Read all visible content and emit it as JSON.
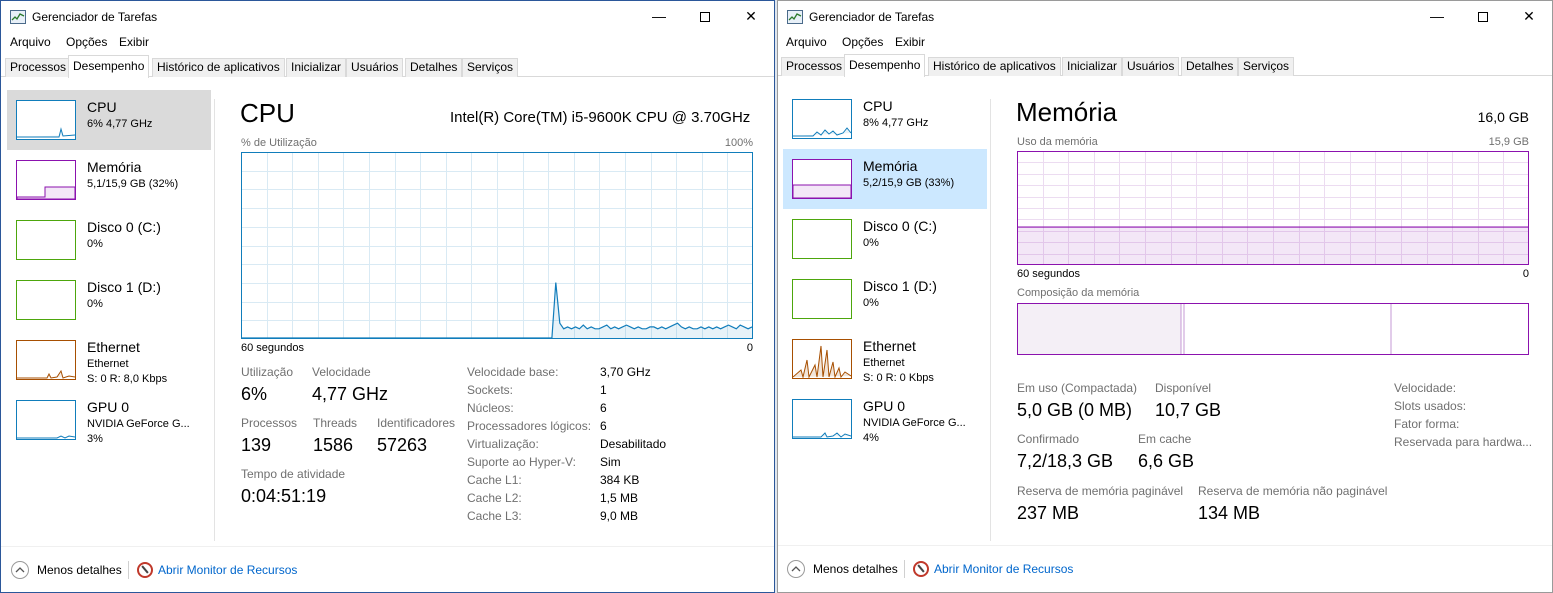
{
  "windowA": {
    "title": "Gerenciador de Tarefas",
    "window_buttons": {
      "minimize": "—",
      "close": "✕"
    },
    "menu": [
      "Arquivo",
      "Opções",
      "Exibir"
    ],
    "tabs": [
      "Processos",
      "Desempenho",
      "Histórico de aplicativos",
      "Inicializar",
      "Usuários",
      "Detalhes",
      "Serviços"
    ],
    "active_tab": "Desempenho",
    "sidebar": [
      {
        "title": "CPU",
        "sub": "6% 4,77 GHz",
        "sub2": ""
      },
      {
        "title": "Memória",
        "sub": "5,1/15,9 GB (32%)",
        "sub2": ""
      },
      {
        "title": "Disco 0 (C:)",
        "sub": "0%",
        "sub2": ""
      },
      {
        "title": "Disco 1 (D:)",
        "sub": "0%",
        "sub2": ""
      },
      {
        "title": "Ethernet",
        "sub": "Ethernet",
        "sub2": "S: 0 R: 8,0 Kbps"
      },
      {
        "title": "GPU 0",
        "sub": "NVIDIA GeForce G...",
        "sub2": "3%"
      }
    ],
    "panel": {
      "title": "CPU",
      "processor": "Intel(R) Core(TM) i5-9600K CPU @ 3.70GHz",
      "graph_label_left": "% de Utilização",
      "graph_label_right": "100%",
      "graph_bottom_left": "60 segundos",
      "graph_bottom_right": "0",
      "stats": {
        "utilizacao_label": "Utilização",
        "utilizacao": "6%",
        "velocidade_label": "Velocidade",
        "velocidade": "4,77 GHz",
        "processos_label": "Processos",
        "processos": "139",
        "threads_label": "Threads",
        "threads": "1586",
        "identificadores_label": "Identificadores",
        "identificadores": "57263",
        "tempo_label": "Tempo de atividade",
        "tempo": "0:04:51:19"
      },
      "details": [
        {
          "k": "Velocidade base:",
          "v": "3,70 GHz"
        },
        {
          "k": "Sockets:",
          "v": "1"
        },
        {
          "k": "Núcleos:",
          "v": "6"
        },
        {
          "k": "Processadores lógicos:",
          "v": "6"
        },
        {
          "k": "Virtualização:",
          "v": "Desabilitado"
        },
        {
          "k": "Suporte ao Hyper-V:",
          "v": "Sim"
        },
        {
          "k": "Cache L1:",
          "v": "384 KB"
        },
        {
          "k": "Cache L2:",
          "v": "1,5 MB"
        },
        {
          "k": "Cache L3:",
          "v": "9,0 MB"
        }
      ],
      "cpu_usage_series": [
        0,
        0,
        0,
        0,
        0,
        0,
        0,
        0,
        0,
        0,
        0,
        0,
        0,
        0,
        0,
        0,
        0,
        0,
        0,
        0,
        0,
        0,
        0,
        0,
        0,
        0,
        0,
        0,
        0,
        0,
        0,
        0,
        0,
        0,
        0,
        0,
        0,
        0,
        0,
        0,
        0,
        0,
        0,
        0,
        0,
        0,
        0,
        0,
        0,
        0,
        0,
        0,
        0,
        0,
        0,
        0,
        0,
        0,
        0,
        0,
        0,
        0,
        0,
        0,
        0,
        0,
        0,
        0,
        0,
        0,
        0,
        0,
        0,
        0,
        0,
        0,
        0,
        0,
        0,
        0,
        30,
        8,
        5,
        6,
        5,
        6,
        5,
        7,
        5,
        6,
        5,
        5,
        6,
        7,
        5,
        6,
        5,
        6,
        7,
        6,
        5,
        6,
        5,
        5,
        6,
        6,
        5,
        6,
        5,
        6,
        7,
        8,
        6,
        5,
        6,
        5,
        5,
        6,
        5,
        6,
        5,
        6,
        5,
        6,
        7,
        6,
        5,
        7,
        6,
        5,
        6
      ]
    },
    "footer": {
      "less": "Menos detalhes",
      "monitor": "Abrir Monitor de Recursos"
    }
  },
  "windowB": {
    "title": "Gerenciador de Tarefas",
    "window_buttons": {
      "minimize": "—",
      "close": "✕"
    },
    "menu": [
      "Arquivo",
      "Opções",
      "Exibir"
    ],
    "tabs": [
      "Processos",
      "Desempenho",
      "Histórico de aplicativos",
      "Inicializar",
      "Usuários",
      "Detalhes",
      "Serviços"
    ],
    "active_tab": "Desempenho",
    "sidebar": [
      {
        "title": "CPU",
        "sub": "8% 4,77 GHz",
        "sub2": ""
      },
      {
        "title": "Memória",
        "sub": "5,2/15,9 GB (33%)",
        "sub2": ""
      },
      {
        "title": "Disco 0 (C:)",
        "sub": "0%",
        "sub2": ""
      },
      {
        "title": "Disco 1 (D:)",
        "sub": "0%",
        "sub2": ""
      },
      {
        "title": "Ethernet",
        "sub": "Ethernet",
        "sub2": "S: 0 R: 0 Kbps"
      },
      {
        "title": "GPU 0",
        "sub": "NVIDIA GeForce G...",
        "sub2": "4%"
      }
    ],
    "panel": {
      "title": "Memória",
      "total": "16,0 GB",
      "graph_label_left": "Uso da memória",
      "graph_label_right": "15,9 GB",
      "graph_bottom_left": "60 segundos",
      "graph_bottom_right": "0",
      "composition_label": "Composição da memória",
      "memory_usage_fraction": 0.33,
      "stats": {
        "em_uso_label": "Em uso (Compactada)",
        "em_uso": "5,0 GB (0 MB)",
        "disponivel_label": "Disponível",
        "disponivel": "10,7 GB",
        "confirmado_label": "Confirmado",
        "confirmado": "7,2/18,3 GB",
        "cache_label": "Em cache",
        "cache": "6,6 GB",
        "paginavel_label": "Reserva de memória paginável",
        "paginavel": "237 MB",
        "nao_paginavel_label": "Reserva de memória não paginável",
        "nao_paginavel": "134 MB"
      },
      "details": [
        {
          "k": "Velocidade:"
        },
        {
          "k": "Slots usados:"
        },
        {
          "k": "Fator forma:"
        },
        {
          "k": "Reservada para hardwa..."
        }
      ]
    },
    "footer": {
      "less": "Menos detalhes",
      "monitor": "Abrir Monitor de Recursos"
    }
  },
  "colors": {
    "cpu": "#117dbb",
    "memory": "#8b12ae",
    "disk": "#4da60c",
    "ethernet": "#a74f01",
    "gpu": "#117dbb",
    "selected_gray": "#dadada",
    "selected_blue": "#cce8ff",
    "link": "#0066cc"
  },
  "icons": [
    "task-manager-icon",
    "minimize-icon",
    "maximize-icon",
    "close-icon",
    "chevron-up-icon",
    "resource-monitor-icon"
  ]
}
